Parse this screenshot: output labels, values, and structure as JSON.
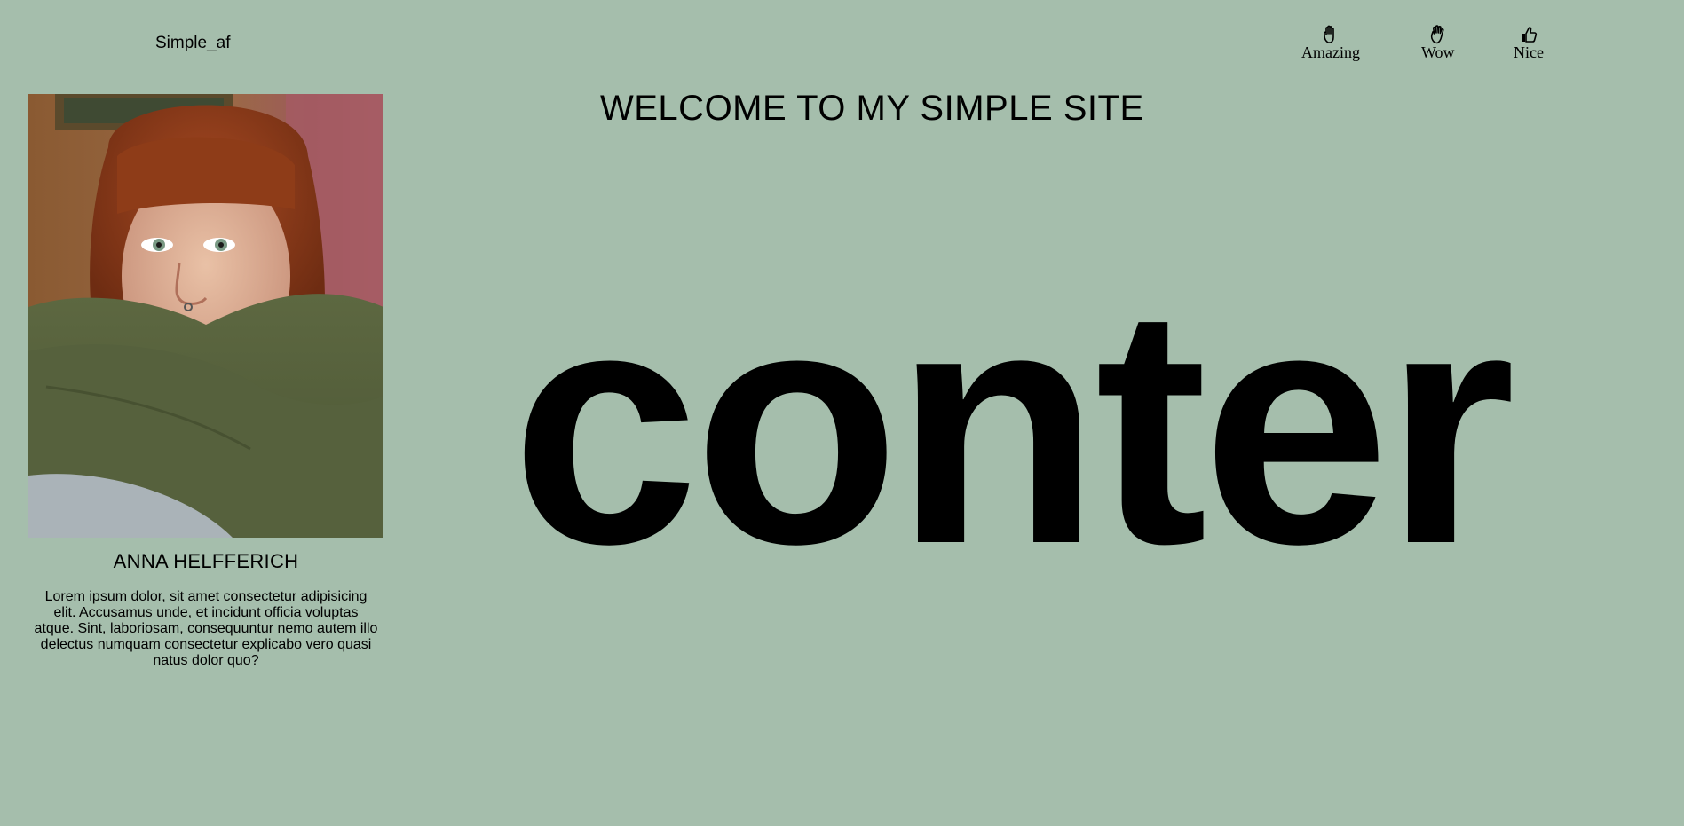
{
  "header": {
    "brand": "Simple_af",
    "nav": [
      {
        "label": "Amazing",
        "icon": "hand-icon"
      },
      {
        "label": "Wow",
        "icon": "hand-wave-icon"
      },
      {
        "label": "Nice",
        "icon": "thumbs-up-icon"
      }
    ]
  },
  "main": {
    "welcome": "WELCOME TO MY SIMPLE SITE",
    "hero_word": "conter"
  },
  "profile": {
    "name": "ANNA HELFFERICH",
    "bio": "Lorem ipsum dolor, sit amet consectetur adipisicing elit. Accusamus unde, et incidunt officia voluptas atque. Sint, laboriosam, consequuntur nemo autem illo delectus numquam consectetur explicabo vero quasi natus dolor quo?"
  },
  "colors": {
    "background": "#a5beac",
    "text": "#000000"
  }
}
